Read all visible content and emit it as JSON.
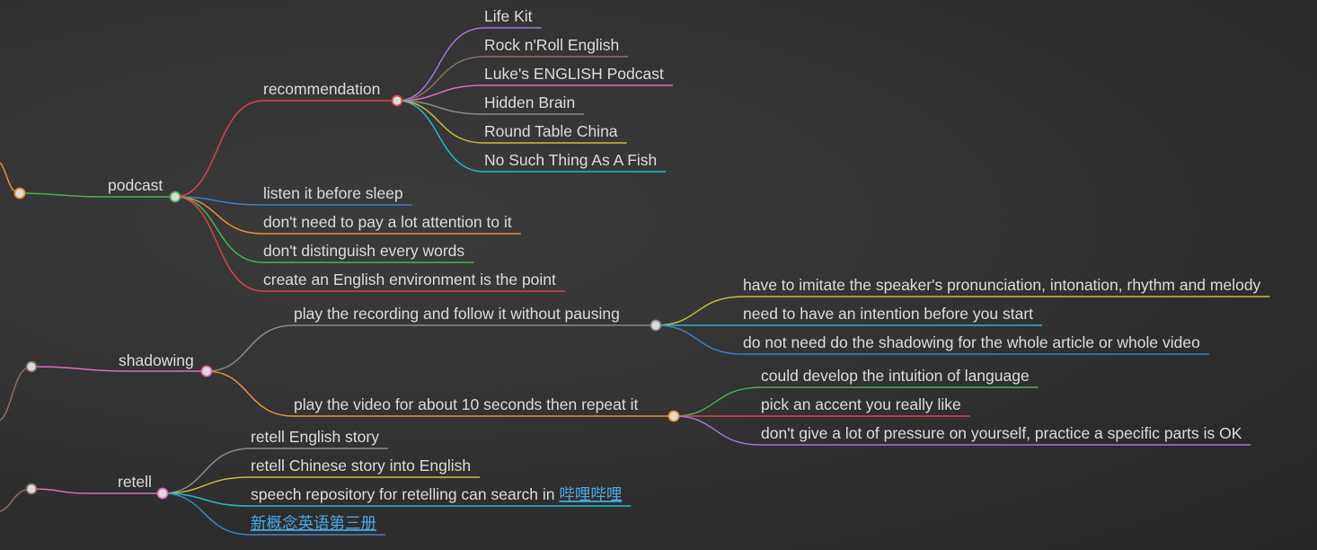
{
  "mindmap": {
    "branches": [
      {
        "label": "podcast",
        "color": "#e69138",
        "child_color": "#4caf50",
        "ring": "#4caf50",
        "groups": [
          {
            "label": "recommendation",
            "color": "#d9434d",
            "ring": "#d9434d",
            "items": [
              {
                "label": "Life Kit",
                "color": "#a277d6"
              },
              {
                "label": "Rock n'Roll English",
                "color": "#8d6e63"
              },
              {
                "label": "Luke's ENGLISH Podcast",
                "color": "#e06bbd"
              },
              {
                "label": "Hidden Brain",
                "color": "#8a8a8a"
              },
              {
                "label": "Round Table China",
                "color": "#c8bf3a"
              },
              {
                "label": "No Such Thing As A Fish",
                "color": "#26b8c9"
              }
            ]
          }
        ],
        "leaves": [
          {
            "label": "listen it before sleep",
            "color": "#3f7fc4"
          },
          {
            "label": "don't need to pay a lot attention to it",
            "color": "#e69138"
          },
          {
            "label": "don't distinguish every words",
            "color": "#4caf50"
          },
          {
            "label": "create an English environment is the point",
            "color": "#d9434d"
          }
        ]
      },
      {
        "label": "shadowing",
        "color": "#8d6e63",
        "child_color": "#e06bbd",
        "ring": "#e06bbd",
        "groups": [
          {
            "label": "play the recording and follow it without pausing",
            "color": "#8a8a8a",
            "ring": "#8a8a8a",
            "items": [
              {
                "label": "have to imitate the speaker's pronunciation, intonation, rhythm and melody",
                "color": "#c8bf3a"
              },
              {
                "label": "need to have an intention before you start",
                "color": "#26b8c9"
              },
              {
                "label": "do not need do the shadowing for the whole article or whole video",
                "color": "#3f7fc4"
              }
            ]
          },
          {
            "label": "play the video for about 10 seconds then repeat it",
            "color": "#e69138",
            "ring": "#e69138",
            "items": [
              {
                "label": "could develop the intuition of language",
                "color": "#4caf50"
              },
              {
                "label": "pick an accent you really like",
                "color": "#d9434d"
              },
              {
                "label": "don't give a lot of pressure on yourself, practice a specific parts is OK",
                "color": "#a277d6"
              }
            ]
          }
        ],
        "leaves": []
      },
      {
        "label": "retell",
        "color": "#8d6e63",
        "child_color": "#e06bbd",
        "ring": "#e06bbd",
        "groups": [],
        "leaves": [
          {
            "label": "retell English story",
            "color": "#8a8a8a"
          },
          {
            "label": "retell Chinese story into English",
            "color": "#c8bf3a"
          },
          {
            "label": "speech repository for retelling can search in ",
            "link": "哔哩哔哩",
            "color": "#26b8c9"
          },
          {
            "label": "",
            "link": "新概念英语第三册",
            "color": "#3f7fc4"
          }
        ]
      }
    ]
  }
}
